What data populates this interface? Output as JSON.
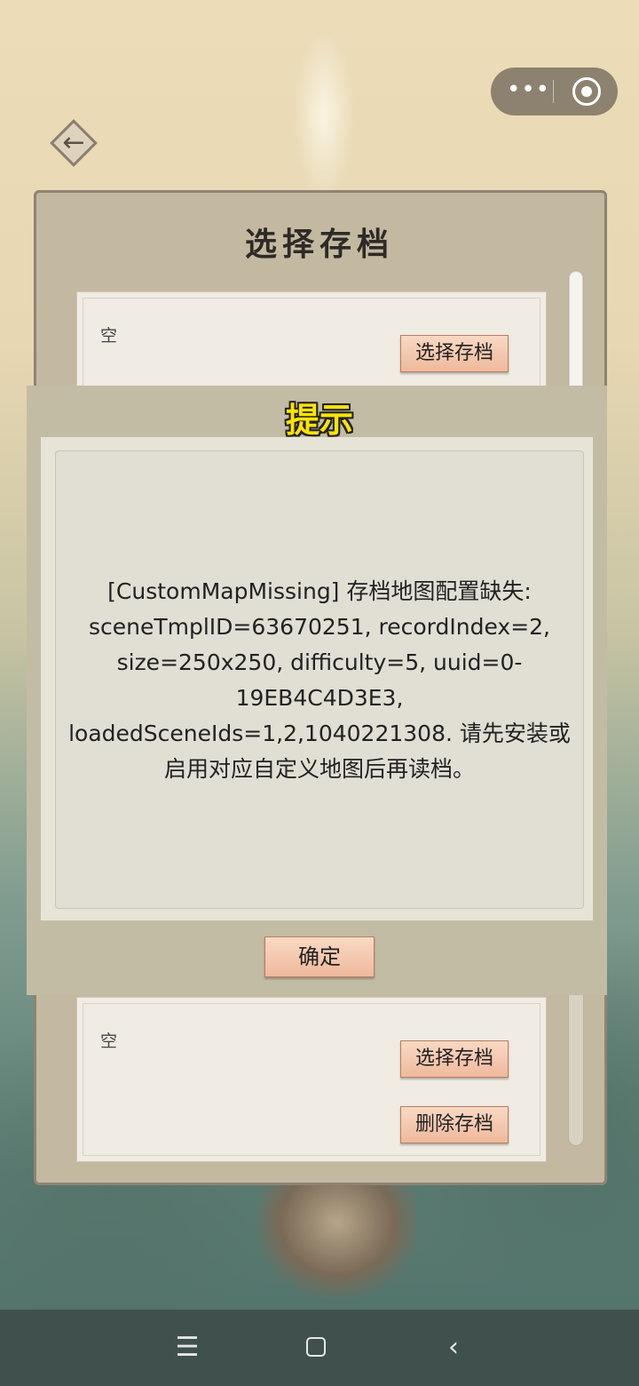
{
  "capsule": {
    "more_icon": "more-dots-icon",
    "close_icon": "target-circle-icon"
  },
  "back": {
    "icon": "back-arrow-icon"
  },
  "panel": {
    "title": "选择存档",
    "slots": [
      {
        "label": "空",
        "select_label": "选择存档"
      },
      {
        "label": "空",
        "select_label": "选择存档",
        "delete_label": "删除存档"
      }
    ]
  },
  "modal": {
    "title": "提示",
    "message": "[CustomMapMissing] 存档地图配置缺失: sceneTmplID=63670251, recordIndex=2, size=250x250, difficulty=5, uuid=0-19EB4C4D3E3, loadedSceneIds=1,2,1040221308. 请先安装或启用对应自定义地图后再读档。",
    "confirm_label": "确定"
  },
  "navbar": {
    "menu_icon": "menu-icon",
    "home_icon": "home-square-icon",
    "back_icon": "back-chevron-icon"
  },
  "colors": {
    "modal_title": "#ffe400",
    "button_fill": "#efb99c",
    "panel": "#c3b9a1"
  }
}
